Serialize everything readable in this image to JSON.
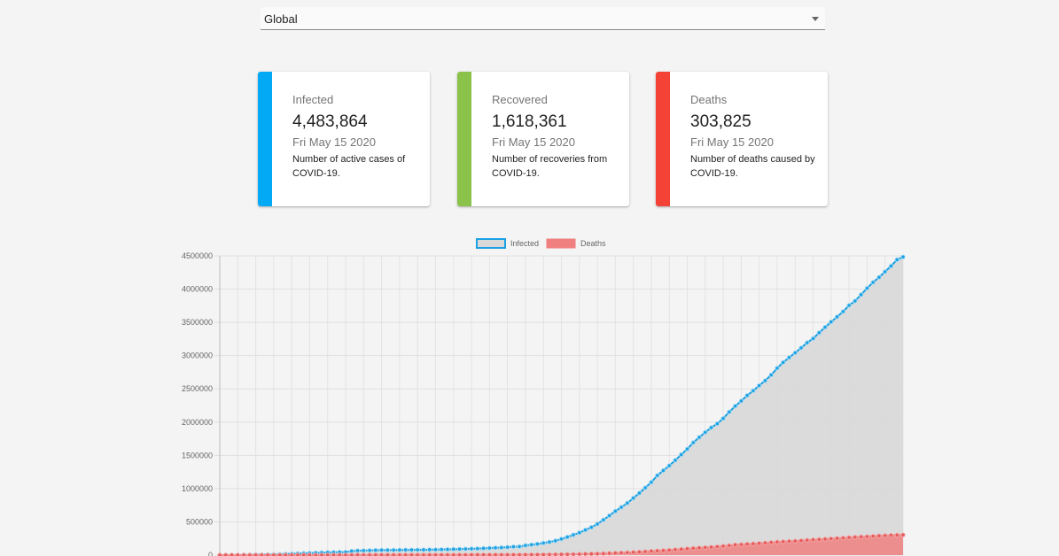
{
  "country_select": {
    "value": "Global"
  },
  "cards": [
    {
      "label": "Infected",
      "value": "4,483,864",
      "date": "Fri May 15 2020",
      "description": "Number of active cases of COVID-19.",
      "color": "#03a9f4"
    },
    {
      "label": "Recovered",
      "value": "1,618,361",
      "date": "Fri May 15 2020",
      "description": "Number of recoveries from COVID-19.",
      "color": "#8bc34a"
    },
    {
      "label": "Deaths",
      "value": "303,825",
      "date": "Fri May 15 2020",
      "description": "Number of deaths caused by COVID-19.",
      "color": "#f44336"
    }
  ],
  "chart_data": {
    "type": "area",
    "legend": [
      {
        "name": "Infected",
        "border": "#1ba1e2",
        "fill": "#d9d9d9"
      },
      {
        "name": "Deaths",
        "border": "#f08080",
        "fill": "#f08080"
      }
    ],
    "legend_position": "top",
    "grid": true,
    "ylim": [
      0,
      4500000
    ],
    "yticks": [
      0,
      500000,
      1000000,
      1500000,
      2000000,
      2500000,
      3000000,
      3500000,
      4000000,
      4500000
    ],
    "n_points": 115,
    "series": [
      {
        "name": "Infected",
        "values": [
          555,
          654,
          941,
          1434,
          2118,
          2927,
          5578,
          6166,
          8234,
          9927,
          12038,
          16787,
          19881,
          23892,
          27635,
          30794,
          34391,
          37120,
          40150,
          42762,
          44802,
          45221,
          60368,
          66885,
          69030,
          71224,
          73258,
          75136,
          75639,
          76197,
          76819,
          78572,
          78958,
          79561,
          80406,
          81388,
          82746,
          84112,
          86011,
          88369,
          90306,
          92840,
          95120,
          97886,
          101801,
          105847,
          109821,
          113590,
          118620,
          125875,
          128352,
          145205,
          156101,
          167454,
          181574,
          197102,
          214821,
          242570,
          272208,
          304507,
          336953,
          378235,
          418045,
          467653,
          529591,
          593291,
          660706,
          720117,
          782365,
          857487,
          932605,
          1013157,
          1095917,
          1197405,
          1272115,
          1345101,
          1426096,
          1511104,
          1595350,
          1691719,
          1771514,
          1846680,
          1917320,
          1976191,
          2056054,
          2152437,
          2240191,
          2317759,
          2401378,
          2472258,
          2549294,
          2623415,
          2708885,
          2811193,
          2897645,
          2971475,
          3041764,
          3116398,
          3193886,
          3256846,
          3343777,
          3427343,
          3506729,
          3583055,
          3662691,
          3755341,
          3822328,
          3916593,
          4013846,
          4101699,
          4177502,
          4261747,
          4347015,
          4442163,
          4483864
        ]
      },
      {
        "name": "Deaths",
        "values": [
          17,
          18,
          26,
          42,
          56,
          82,
          131,
          133,
          171,
          213,
          259,
          362,
          426,
          492,
          564,
          634,
          719,
          806,
          906,
          1013,
          1113,
          1118,
          1371,
          1523,
          1666,
          1770,
          1868,
          2007,
          2122,
          2247,
          2251,
          2458,
          2469,
          2629,
          2708,
          2770,
          2814,
          2872,
          2941,
          2996,
          3085,
          3160,
          3254,
          3348,
          3460,
          3558,
          3802,
          3988,
          4262,
          4615,
          4720,
          5404,
          5819,
          6440,
          7126,
          7905,
          8733,
          9867,
          11299,
          12973,
          14651,
          16505,
          18625,
          21181,
          23970,
          27198,
          30652,
          33925,
          37582,
          42107,
          46809,
          52983,
          58787,
          64606,
          69374,
          74565,
          81865,
          88338,
          95455,
          102525,
          108502,
          114090,
          119481,
          125983,
          134177,
          143800,
          153822,
          159510,
          165044,
          169986,
          176583,
          183066,
          190858,
          197159,
          202846,
          206542,
          211167,
          217153,
          224172,
          229971,
          234704,
          239740,
          245794,
          251537,
          257239,
          263831,
          269567,
          274898,
          279311,
          284134,
          289420,
          293913,
          298165,
          301500,
          303825
        ]
      }
    ]
  }
}
